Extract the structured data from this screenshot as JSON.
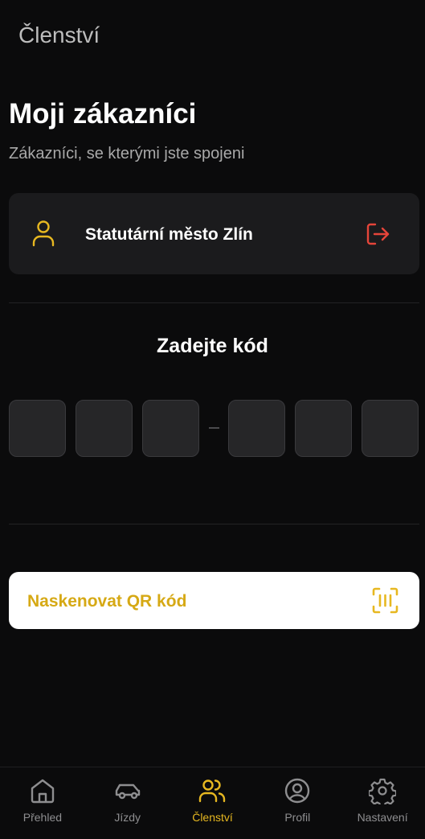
{
  "header": {
    "title": "Členství"
  },
  "main": {
    "title": "Moji zákazníci",
    "subtitle": "Zákazníci, se kterými jste spojeni",
    "customers": [
      {
        "name": "Statutární město Zlín",
        "icon": "user-icon",
        "action_icon": "logout-icon"
      }
    ],
    "code_entry": {
      "title": "Zadejte kód",
      "digits": [
        "",
        "",
        "",
        "",
        "",
        ""
      ],
      "separator": "-"
    },
    "qr_button": {
      "label": "Naskenovat QR kód",
      "icon": "qr-scan-icon"
    }
  },
  "bottom_nav": {
    "items": [
      {
        "label": "Přehled",
        "icon": "home-icon",
        "active": false
      },
      {
        "label": "Jízdy",
        "icon": "car-icon",
        "active": false
      },
      {
        "label": "Členství",
        "icon": "users-icon",
        "active": true
      },
      {
        "label": "Profil",
        "icon": "profile-icon",
        "active": false
      },
      {
        "label": "Nastavení",
        "icon": "gear-icon",
        "active": false
      }
    ]
  },
  "colors": {
    "background": "#0b0b0c",
    "accent": "#e7b821",
    "danger": "#e5453a",
    "card": "#1b1b1d",
    "nav_inactive": "#8e8e90"
  }
}
